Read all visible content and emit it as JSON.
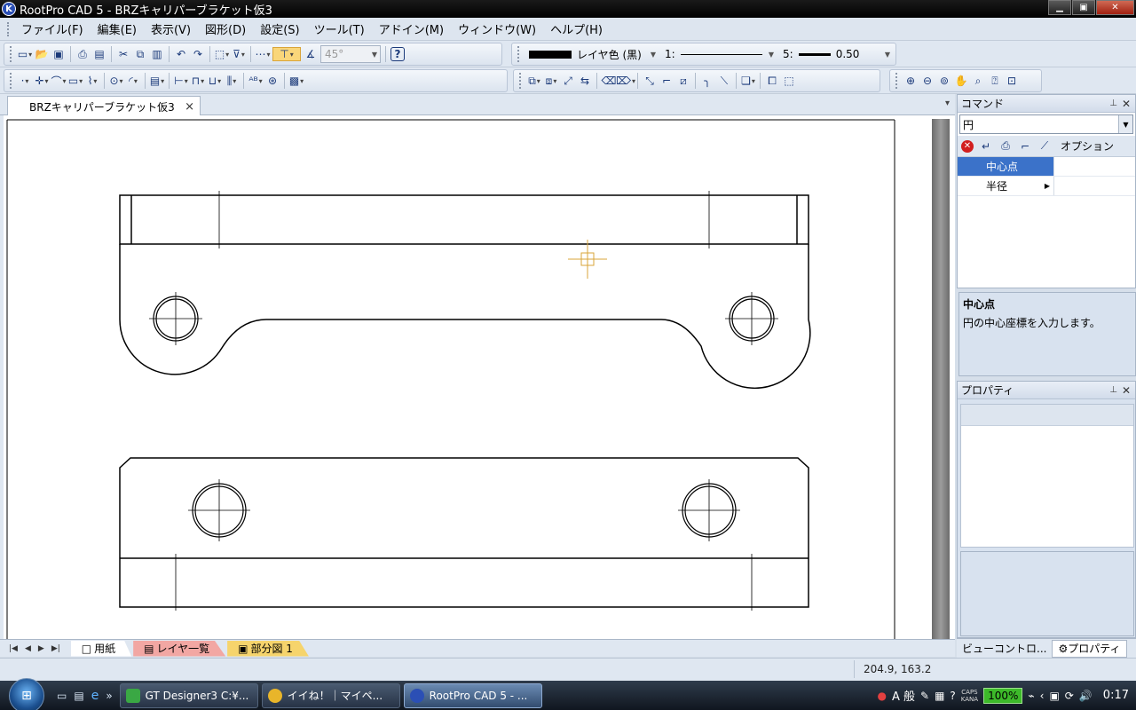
{
  "window": {
    "title": "RootPro CAD 5 - BRZキャリパーブラケット仮3",
    "app_icon_letter": "K",
    "minimize": "▁",
    "maximize": "▣",
    "close": "✕"
  },
  "menu": [
    "ファイル(F)",
    "編集(E)",
    "表示(V)",
    "図形(D)",
    "設定(S)",
    "ツール(T)",
    "アドイン(M)",
    "ウィンドウ(W)",
    "ヘルプ(H)"
  ],
  "toolbar": {
    "angle_value": "45°",
    "layer_color_label": "レイヤ色 (黒)",
    "line_type_label": "1:",
    "line_width_label": "5:",
    "line_width_value": "0.50",
    "help_icon": "?"
  },
  "document": {
    "tab_title": "BRZキャリパーブラケット仮3",
    "tab_close": "×",
    "tab_menu": "▾"
  },
  "sheet_tabs": [
    {
      "label": "用紙",
      "color": "#e6edf6",
      "symbol": "□"
    },
    {
      "label": "レイヤ一覧",
      "color": "#f2a7a3",
      "symbol": "▤"
    },
    {
      "label": "部分図 1",
      "color": "#f6d46c",
      "symbol": "▣"
    }
  ],
  "sheet_nav": [
    "|◀",
    "◀",
    "▶",
    "▶|"
  ],
  "command_panel": {
    "title": "コマンド",
    "command_value": "円",
    "options_label": "オプション",
    "params": [
      {
        "label": "中心点",
        "selected": true,
        "has_submenu": false
      },
      {
        "label": "半径",
        "selected": false,
        "has_submenu": true
      }
    ],
    "help_title": "中心点",
    "help_text": "円の中心座標を入力します。"
  },
  "properties_panel": {
    "title": "プロパティ"
  },
  "bottom_tabs": {
    "view_control": "ビューコントロ...",
    "properties": "プロパティ"
  },
  "status": {
    "coordinates": "204.9, 163.2"
  },
  "taskbar": {
    "start_icon": "⊞",
    "quick_launch_more": "»",
    "tasks": [
      {
        "label": "GT Designer3 C:¥...",
        "color": "#3aa844",
        "active": false
      },
      {
        "label": "イイね！｜マイペ...",
        "color": "#e8b52a",
        "active": false
      },
      {
        "label": "RootPro CAD 5 - ...",
        "color": "#2b4fb5",
        "active": true
      }
    ],
    "tray": {
      "ime": "A 般",
      "caps_line1": "CAPS",
      "caps_line2": "KANA",
      "battery_pct": "100%",
      "clock": "0:17"
    }
  },
  "colors": {
    "accent_selected": "#3b72c9",
    "cursor": "#d9a43a",
    "active_tool": "#f9d67a"
  }
}
